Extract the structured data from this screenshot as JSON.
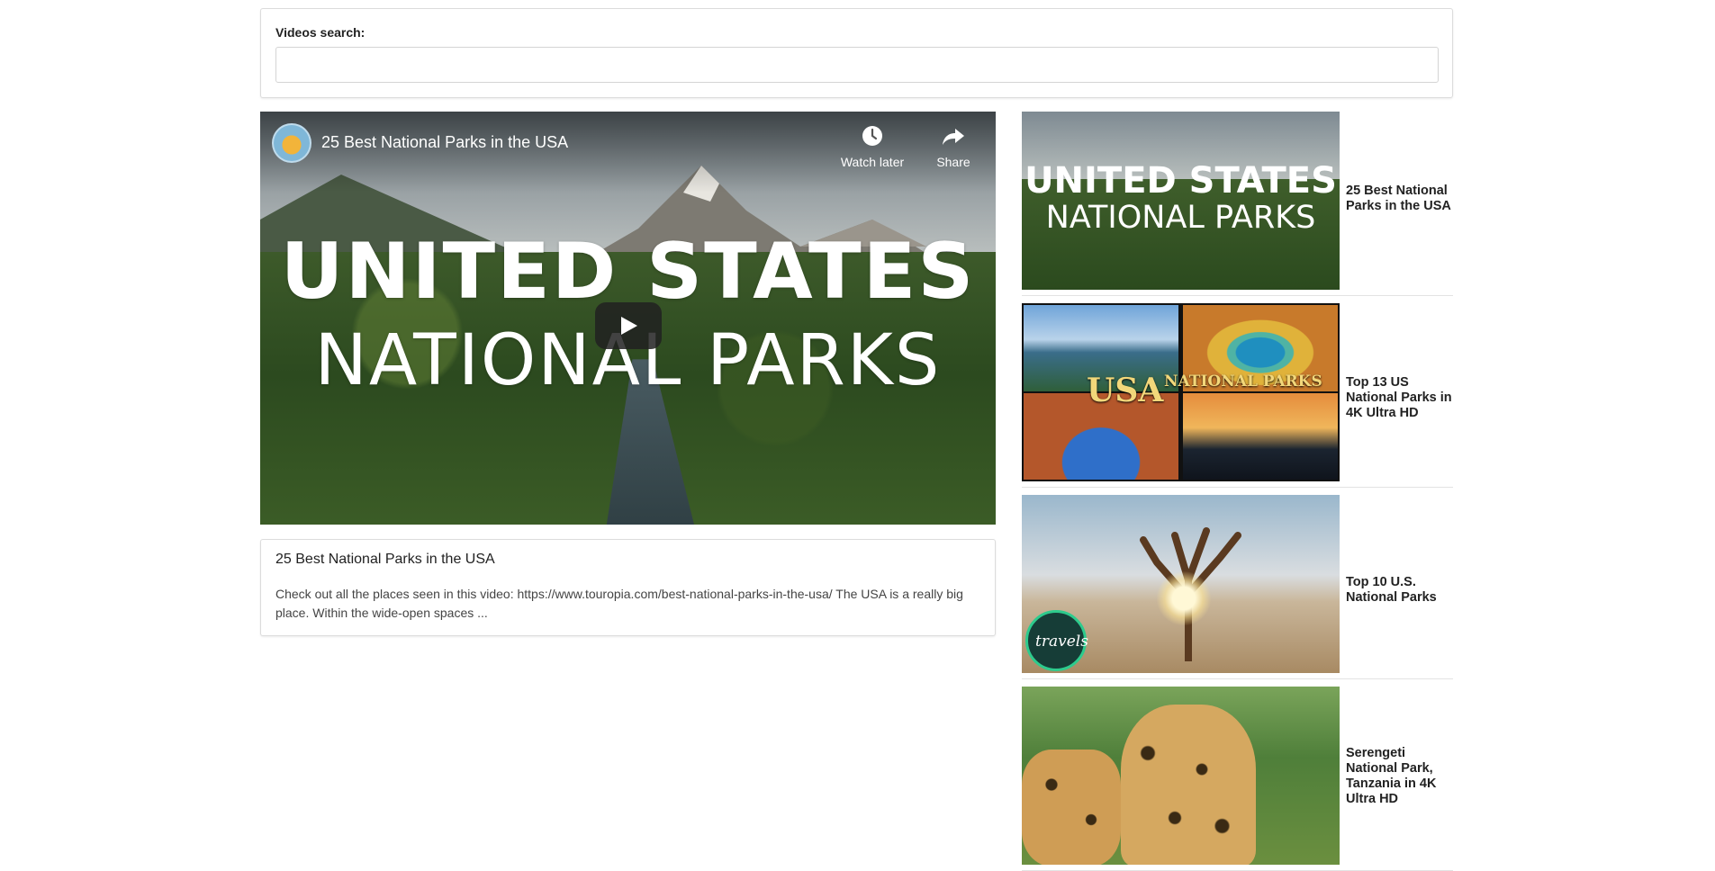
{
  "search": {
    "label": "Videos search:",
    "value": "",
    "placeholder": ""
  },
  "player": {
    "title": "25 Best National Parks in the USA",
    "watch_later_label": "Watch later",
    "share_label": "Share",
    "thumbnail_line1": "UNITED STATES",
    "thumbnail_line2": "NATIONAL PARKS"
  },
  "selected_video": {
    "title": "25 Best National Parks in the USA",
    "description": "Check out all the places seen in this video: https://www.touropia.com/best-national-parks-in-the-usa/ The USA is a really big place. Within the wide-open spaces ..."
  },
  "video_list": [
    {
      "title": "25 Best National Parks in the USA",
      "thumb_line1": "UNITED STATES",
      "thumb_line2": "NATIONAL PARKS"
    },
    {
      "title": "Top 13 US National Parks in 4K Ultra HD",
      "thumb_big": "USA",
      "thumb_small": "NATIONAL PARKS"
    },
    {
      "title": "Top 10 U.S. National Parks",
      "thumb_logo": "travels"
    },
    {
      "title": "Serengeti National Park, Tanzania in 4K Ultra HD"
    }
  ],
  "icons": {
    "watch_later": "clock-icon",
    "share": "share-arrow-icon",
    "play": "play-icon"
  }
}
